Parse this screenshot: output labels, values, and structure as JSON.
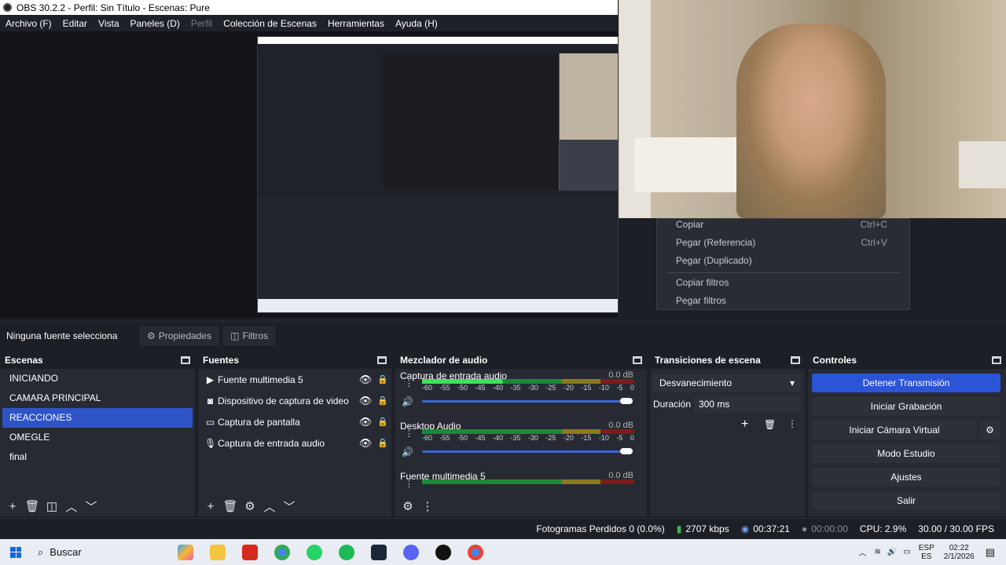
{
  "window": {
    "title": "OBS 30.2.2 - Perfil: Sin Título - Escenas: Pure"
  },
  "menu": [
    "Archivo (F)",
    "Editar",
    "Vista",
    "Paneles (D)",
    "Perfil",
    "Colección de Escenas",
    "Herramientas",
    "Ayuda (H)"
  ],
  "context_menu": {
    "items": [
      {
        "label": "Copiar",
        "shortcut": "Ctrl+C"
      },
      {
        "label": "Pegar (Referencia)",
        "shortcut": "Ctrl+V"
      },
      {
        "label": "Pegar (Duplicado)",
        "shortcut": ""
      },
      {
        "label": "Copiar filtros",
        "shortcut": ""
      },
      {
        "label": "Pegar filtros",
        "shortcut": ""
      }
    ]
  },
  "source_toolbar": {
    "no_selection": "Ninguna fuente selecciona",
    "properties": "Propiedades",
    "filters": "Filtros"
  },
  "scenes": {
    "title": "Escenas",
    "items": [
      "INICIANDO",
      "CAMARA PRINCIPAL",
      "REACCIONES",
      "OMEGLE",
      "final"
    ],
    "selected": "REACCIONES"
  },
  "sources": {
    "title": "Fuentes",
    "items": [
      {
        "name": "Fuente multimedia 5",
        "icon": "play-icon"
      },
      {
        "name": "Dispositivo de captura de video",
        "icon": "camera-icon"
      },
      {
        "name": "Captura de pantalla",
        "icon": "monitor-icon"
      },
      {
        "name": "Captura de entrada audio",
        "icon": "mic-icon"
      }
    ]
  },
  "mixer": {
    "title": "Mezclador de audio",
    "ticks": [
      "-60",
      "-55",
      "-50",
      "-45",
      "-40",
      "-35",
      "-30",
      "-25",
      "-20",
      "-15",
      "-10",
      "-5",
      "0"
    ],
    "channels": [
      {
        "name": "Captura de entrada audio",
        "db": "0.0 dB",
        "level": 0.38
      },
      {
        "name": "Desktop Audio",
        "db": "0.0 dB",
        "level": 0.0
      },
      {
        "name": "Fuente multimedia 5",
        "db": "0.0 dB",
        "level": 0.0
      }
    ]
  },
  "transitions": {
    "title": "Transiciones de escena",
    "selected": "Desvanecimiento",
    "duration_label": "Duración",
    "duration_value": "300 ms"
  },
  "controls": {
    "title": "Controles",
    "buttons": [
      "Detener Transmisión",
      "Iniciar Grabación",
      "Iniciar Cámara Virtual",
      "Modo Estudio",
      "Ajustes",
      "Salir"
    ]
  },
  "status": {
    "dropped": "Fotogramas Perdidos 0 (0.0%)",
    "bitrate": "2707 kbps",
    "stream_time": "00:37:21",
    "rec_time": "00:00:00",
    "cpu": "CPU: 2.9%",
    "fps": "30.00 / 30.00 FPS"
  },
  "taskbar": {
    "search": "Buscar",
    "lang1": "ESP",
    "lang2": "ES",
    "time": "02:22",
    "date": "2/1/2026"
  },
  "colors": {
    "accent": "#2b54d6",
    "selected_scene": "#2f54c8"
  }
}
